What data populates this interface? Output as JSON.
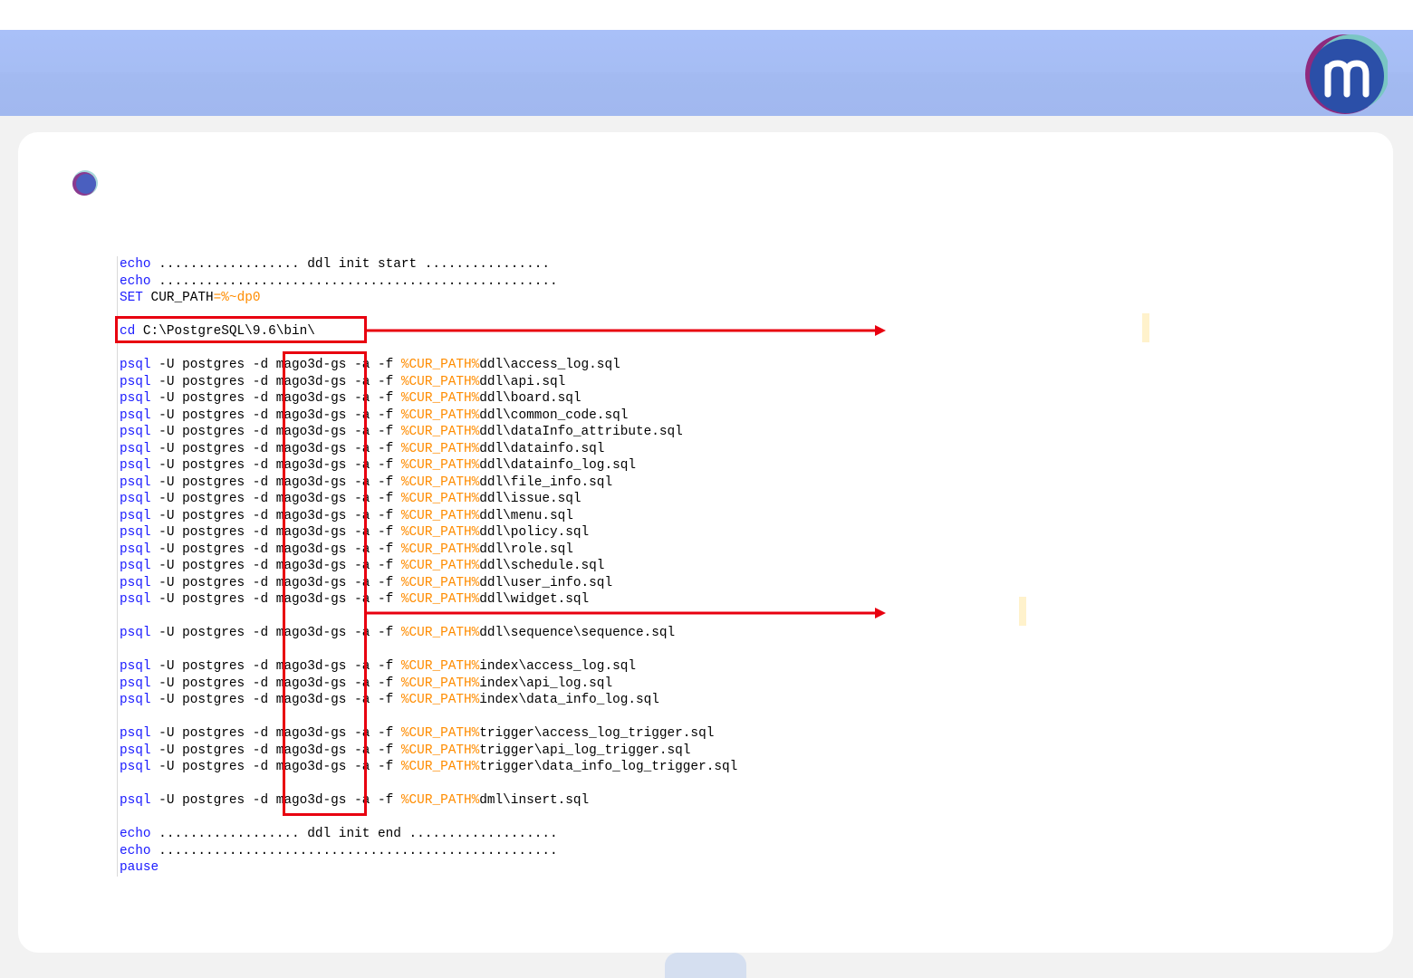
{
  "colors": {
    "header": "#a6bdf4",
    "keyword": "#1a1aff",
    "variable": "#ff8c00",
    "highlight": "#e8000f",
    "note": "#fff2cc"
  },
  "logo": {
    "icon": "m-logo-icon"
  },
  "code": {
    "lines": [
      {
        "kw": "echo",
        "text": " .................. ddl init start ................"
      },
      {
        "kw": "echo",
        "text": " ..................................................."
      },
      {
        "kw": "SET",
        "text": " CUR_PATH",
        "var": "=%~dp0",
        "rest": ""
      },
      {
        "blank": true
      },
      {
        "kw": "cd",
        "text": " C:\\PostgreSQL\\9.6\\bin\\"
      },
      {
        "blank": true
      },
      {
        "kw": "psql",
        "text": " -U postgres -d mago3d-gs -a -f ",
        "var": "%CUR_PATH%",
        "rest": "ddl\\access_log.sql"
      },
      {
        "kw": "psql",
        "text": " -U postgres -d mago3d-gs -a -f ",
        "var": "%CUR_PATH%",
        "rest": "ddl\\api.sql"
      },
      {
        "kw": "psql",
        "text": " -U postgres -d mago3d-gs -a -f ",
        "var": "%CUR_PATH%",
        "rest": "ddl\\board.sql"
      },
      {
        "kw": "psql",
        "text": " -U postgres -d mago3d-gs -a -f ",
        "var": "%CUR_PATH%",
        "rest": "ddl\\common_code.sql"
      },
      {
        "kw": "psql",
        "text": " -U postgres -d mago3d-gs -a -f ",
        "var": "%CUR_PATH%",
        "rest": "ddl\\dataInfo_attribute.sql"
      },
      {
        "kw": "psql",
        "text": " -U postgres -d mago3d-gs -a -f ",
        "var": "%CUR_PATH%",
        "rest": "ddl\\datainfo.sql"
      },
      {
        "kw": "psql",
        "text": " -U postgres -d mago3d-gs -a -f ",
        "var": "%CUR_PATH%",
        "rest": "ddl\\datainfo_log.sql"
      },
      {
        "kw": "psql",
        "text": " -U postgres -d mago3d-gs -a -f ",
        "var": "%CUR_PATH%",
        "rest": "ddl\\file_info.sql"
      },
      {
        "kw": "psql",
        "text": " -U postgres -d mago3d-gs -a -f ",
        "var": "%CUR_PATH%",
        "rest": "ddl\\issue.sql"
      },
      {
        "kw": "psql",
        "text": " -U postgres -d mago3d-gs -a -f ",
        "var": "%CUR_PATH%",
        "rest": "ddl\\menu.sql"
      },
      {
        "kw": "psql",
        "text": " -U postgres -d mago3d-gs -a -f ",
        "var": "%CUR_PATH%",
        "rest": "ddl\\policy.sql"
      },
      {
        "kw": "psql",
        "text": " -U postgres -d mago3d-gs -a -f ",
        "var": "%CUR_PATH%",
        "rest": "ddl\\role.sql"
      },
      {
        "kw": "psql",
        "text": " -U postgres -d mago3d-gs -a -f ",
        "var": "%CUR_PATH%",
        "rest": "ddl\\schedule.sql"
      },
      {
        "kw": "psql",
        "text": " -U postgres -d mago3d-gs -a -f ",
        "var": "%CUR_PATH%",
        "rest": "ddl\\user_info.sql"
      },
      {
        "kw": "psql",
        "text": " -U postgres -d mago3d-gs -a -f ",
        "var": "%CUR_PATH%",
        "rest": "ddl\\widget.sql"
      },
      {
        "blank": true
      },
      {
        "kw": "psql",
        "text": " -U postgres -d mago3d-gs -a -f ",
        "var": "%CUR_PATH%",
        "rest": "ddl\\sequence\\sequence.sql"
      },
      {
        "blank": true
      },
      {
        "kw": "psql",
        "text": " -U postgres -d mago3d-gs -a -f ",
        "var": "%CUR_PATH%",
        "rest": "index\\access_log.sql"
      },
      {
        "kw": "psql",
        "text": " -U postgres -d mago3d-gs -a -f ",
        "var": "%CUR_PATH%",
        "rest": "index\\api_log.sql"
      },
      {
        "kw": "psql",
        "text": " -U postgres -d mago3d-gs -a -f ",
        "var": "%CUR_PATH%",
        "rest": "index\\data_info_log.sql"
      },
      {
        "blank": true
      },
      {
        "kw": "psql",
        "text": " -U postgres -d mago3d-gs -a -f ",
        "var": "%CUR_PATH%",
        "rest": "trigger\\access_log_trigger.sql"
      },
      {
        "kw": "psql",
        "text": " -U postgres -d mago3d-gs -a -f ",
        "var": "%CUR_PATH%",
        "rest": "trigger\\api_log_trigger.sql"
      },
      {
        "kw": "psql",
        "text": " -U postgres -d mago3d-gs -a -f ",
        "var": "%CUR_PATH%",
        "rest": "trigger\\data_info_log_trigger.sql"
      },
      {
        "blank": true
      },
      {
        "kw": "psql",
        "text": " -U postgres -d mago3d-gs -a -f ",
        "var": "%CUR_PATH%",
        "rest": "dml\\insert.sql"
      },
      {
        "blank": true
      },
      {
        "kw": "echo",
        "text": " .................. ddl init end ..................."
      },
      {
        "kw": "echo",
        "text": " ..................................................."
      },
      {
        "kw": "pause",
        "text": ""
      }
    ]
  }
}
